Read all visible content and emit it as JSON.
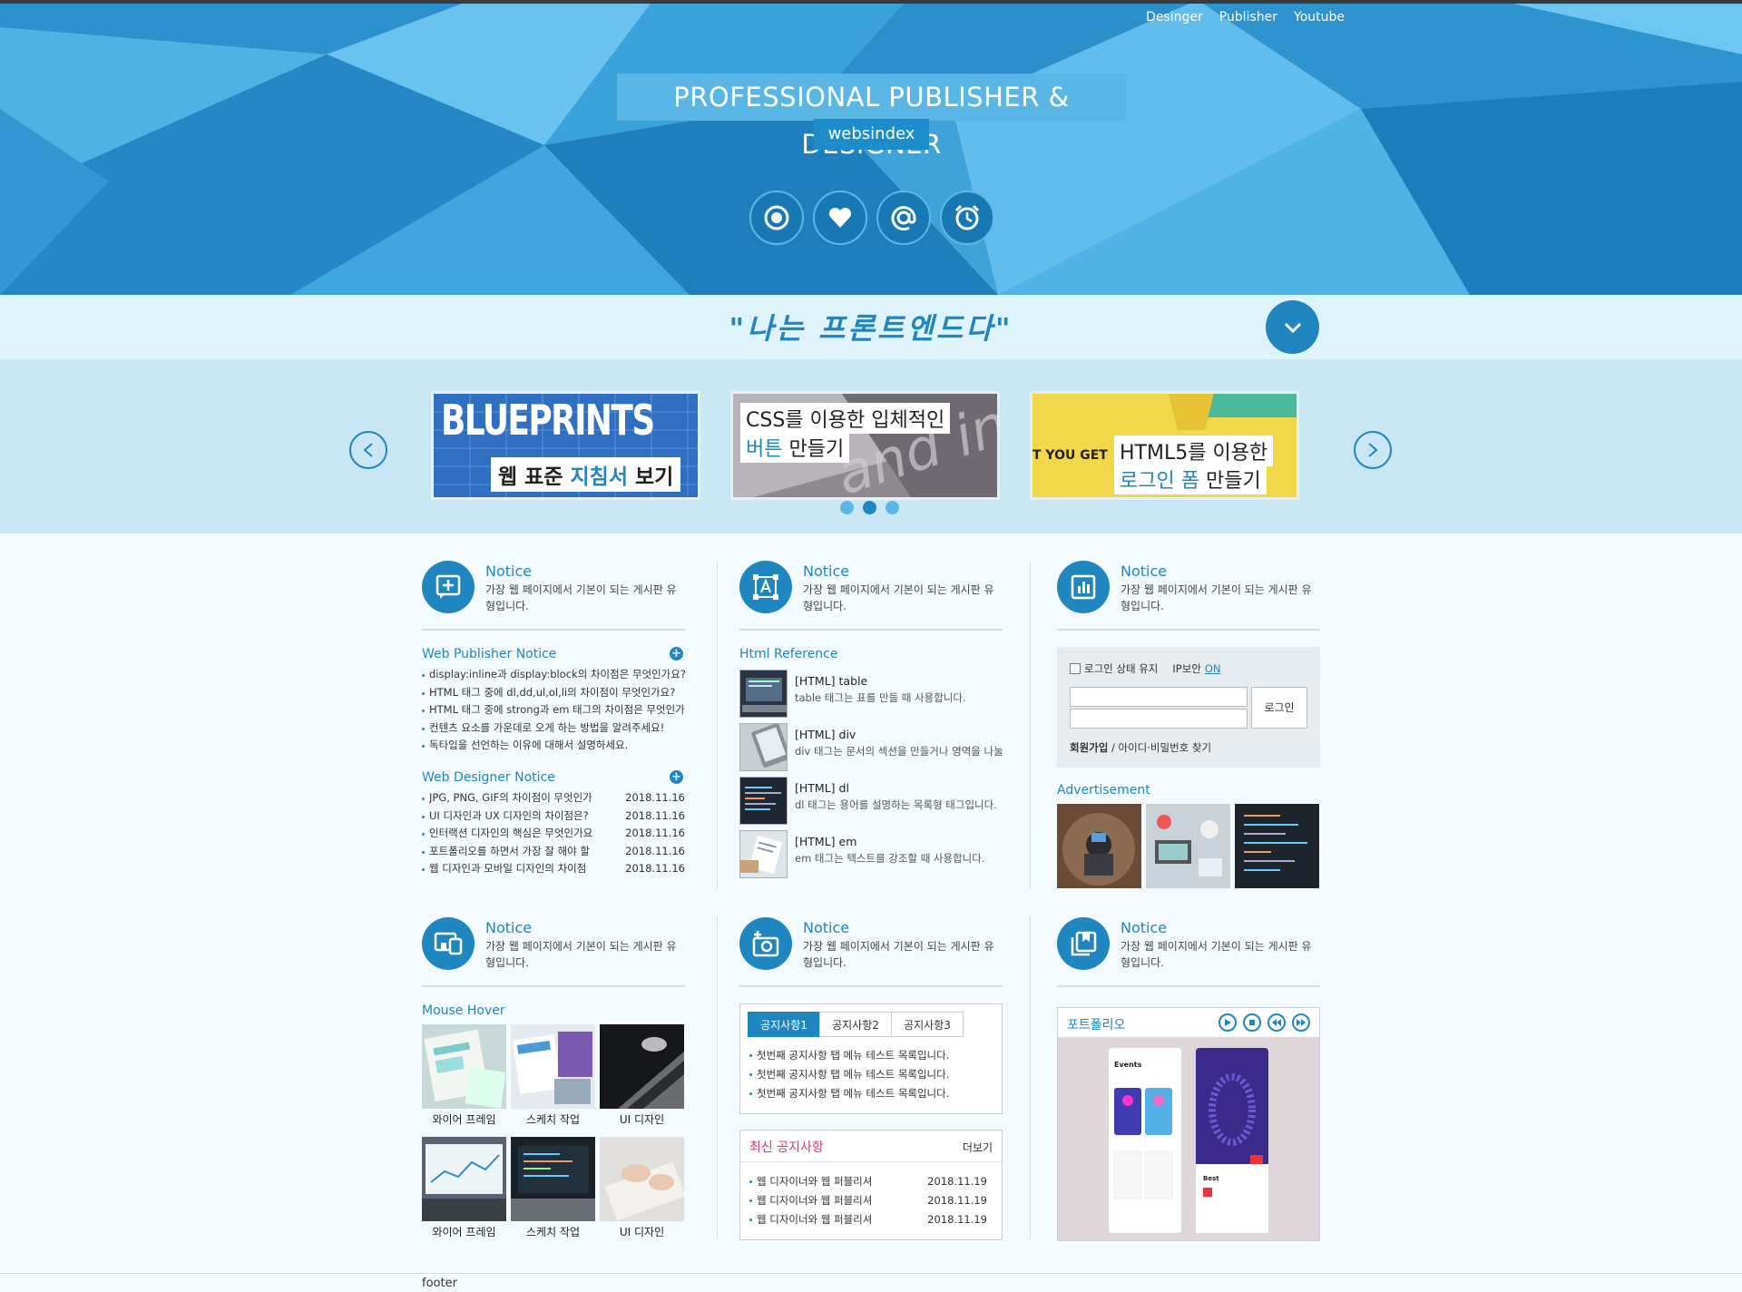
{
  "topnav": [
    "Desinger",
    "Publisher",
    "Youtube"
  ],
  "hero": {
    "title": "PROFESSIONAL PUBLISHER & DESIGNER",
    "subtitle": "websindex"
  },
  "hero_icons": [
    "record-icon",
    "heart-icon",
    "at-icon",
    "alarm-icon"
  ],
  "slogan": "\"나는 프론트엔드다\"",
  "slides": [
    {
      "big": "BLUEPRINTS",
      "line1": "웹 표준 ",
      "hl1": "지침서",
      "line1b": " 보기"
    },
    {
      "line1": "CSS를 이용한 입체적인",
      "hl2": "버튼",
      "line2": " 만들기",
      "bgtext": "and inte"
    },
    {
      "small": "T YOU GET",
      "line1": "HTML5를 이용한",
      "hl2": "로그인 폼",
      "line2": " 만들기"
    }
  ],
  "notice_heading": {
    "title": "Notice",
    "desc": "가장 웹 페이지에서 기본이 되는 게시판 유형입니다."
  },
  "pub_notice": {
    "title": "Web Publisher Notice",
    "items": [
      "display:inline과 display:block의 차이점은 무엇인가요?",
      "HTML 태그 중에 dl,dd,ul,ol,li의 차이점이 무엇인가요?",
      "HTML 태그 중에 strong과 em 태그의 차이점은 무엇인가요?",
      "컨텐츠 요소를 가운데로 오게 하는 방법을 알려주세요!",
      "독타입을 선언하는 이유에 대해서 설명하세요."
    ]
  },
  "des_notice": {
    "title": "Web Designer Notice",
    "items": [
      {
        "t": "JPG, PNG, GIF의 차이점이 무엇인가요?",
        "d": "2018.11.16"
      },
      {
        "t": "UI 디자인과 UX 디자인의 차이점은?",
        "d": "2018.11.16"
      },
      {
        "t": "인터랙션 디자인의 핵심은 무엇인가요?",
        "d": "2018.11.16"
      },
      {
        "t": "포트폴리오를 하면서 가장 잘 해야 할 점",
        "d": "2018.11.16"
      },
      {
        "t": "웹 디자인과 모바일 디자인의 차이점",
        "d": "2018.11.16"
      }
    ]
  },
  "html_ref": {
    "title": "Html Reference",
    "items": [
      {
        "t": "[HTML] table",
        "d": "table 태그는 표를 만들 때 사용합니다."
      },
      {
        "t": "[HTML] div",
        "d": "div 태그는 문서의 섹션을 만들거나 영역을 나눌 때 사용합니다."
      },
      {
        "t": "[HTML] dl",
        "d": "dl 태그는 용어를 설명하는 목록형 태그입니다."
      },
      {
        "t": "[HTML] em",
        "d": "em 태그는 텍스트를 강조할 때 사용합니다."
      }
    ]
  },
  "login": {
    "keep": "로그인 상태 유지",
    "ipsec": "IP보안",
    "on": "ON",
    "button": "로그인",
    "join": "회원가입",
    "find": " / 아이디·비밀번호 찾기"
  },
  "ad": {
    "title": "Advertisement"
  },
  "hover": {
    "title": "Mouse Hover",
    "captions": [
      "와이어 프레임",
      "스케치 작업",
      "UI 디자인",
      "와이어 프레임",
      "스케치 작업",
      "UI 디자인"
    ]
  },
  "tabs": {
    "labels": [
      "공지사항1",
      "공지사항2",
      "공지사항3"
    ],
    "items": [
      "첫번째 공지사항 탭 메뉴 테스트 목록입니다.",
      "첫번째 공지사항 탭 메뉴 테스트 목록입니다.",
      "첫번째 공지사항 탭 메뉴 테스트 목록입니다."
    ]
  },
  "news": {
    "title": "최신 공지사항",
    "more": "더보기",
    "items": [
      {
        "t": "웹 디자이너와 웹 퍼블리셔",
        "d": "2018.11.19"
      },
      {
        "t": "웹 디자이너와 웹 퍼블리셔",
        "d": "2018.11.19"
      },
      {
        "t": "웹 디자이너와 웹 퍼블리셔",
        "d": "2018.11.19"
      }
    ]
  },
  "portfolio": {
    "title": "포트폴리오",
    "app1": "Events",
    "app2": "Best"
  },
  "footer": "footer",
  "colors": {
    "primary": "#1f86c0",
    "hero": "#3fa3d9",
    "light": "#dff3fb"
  }
}
